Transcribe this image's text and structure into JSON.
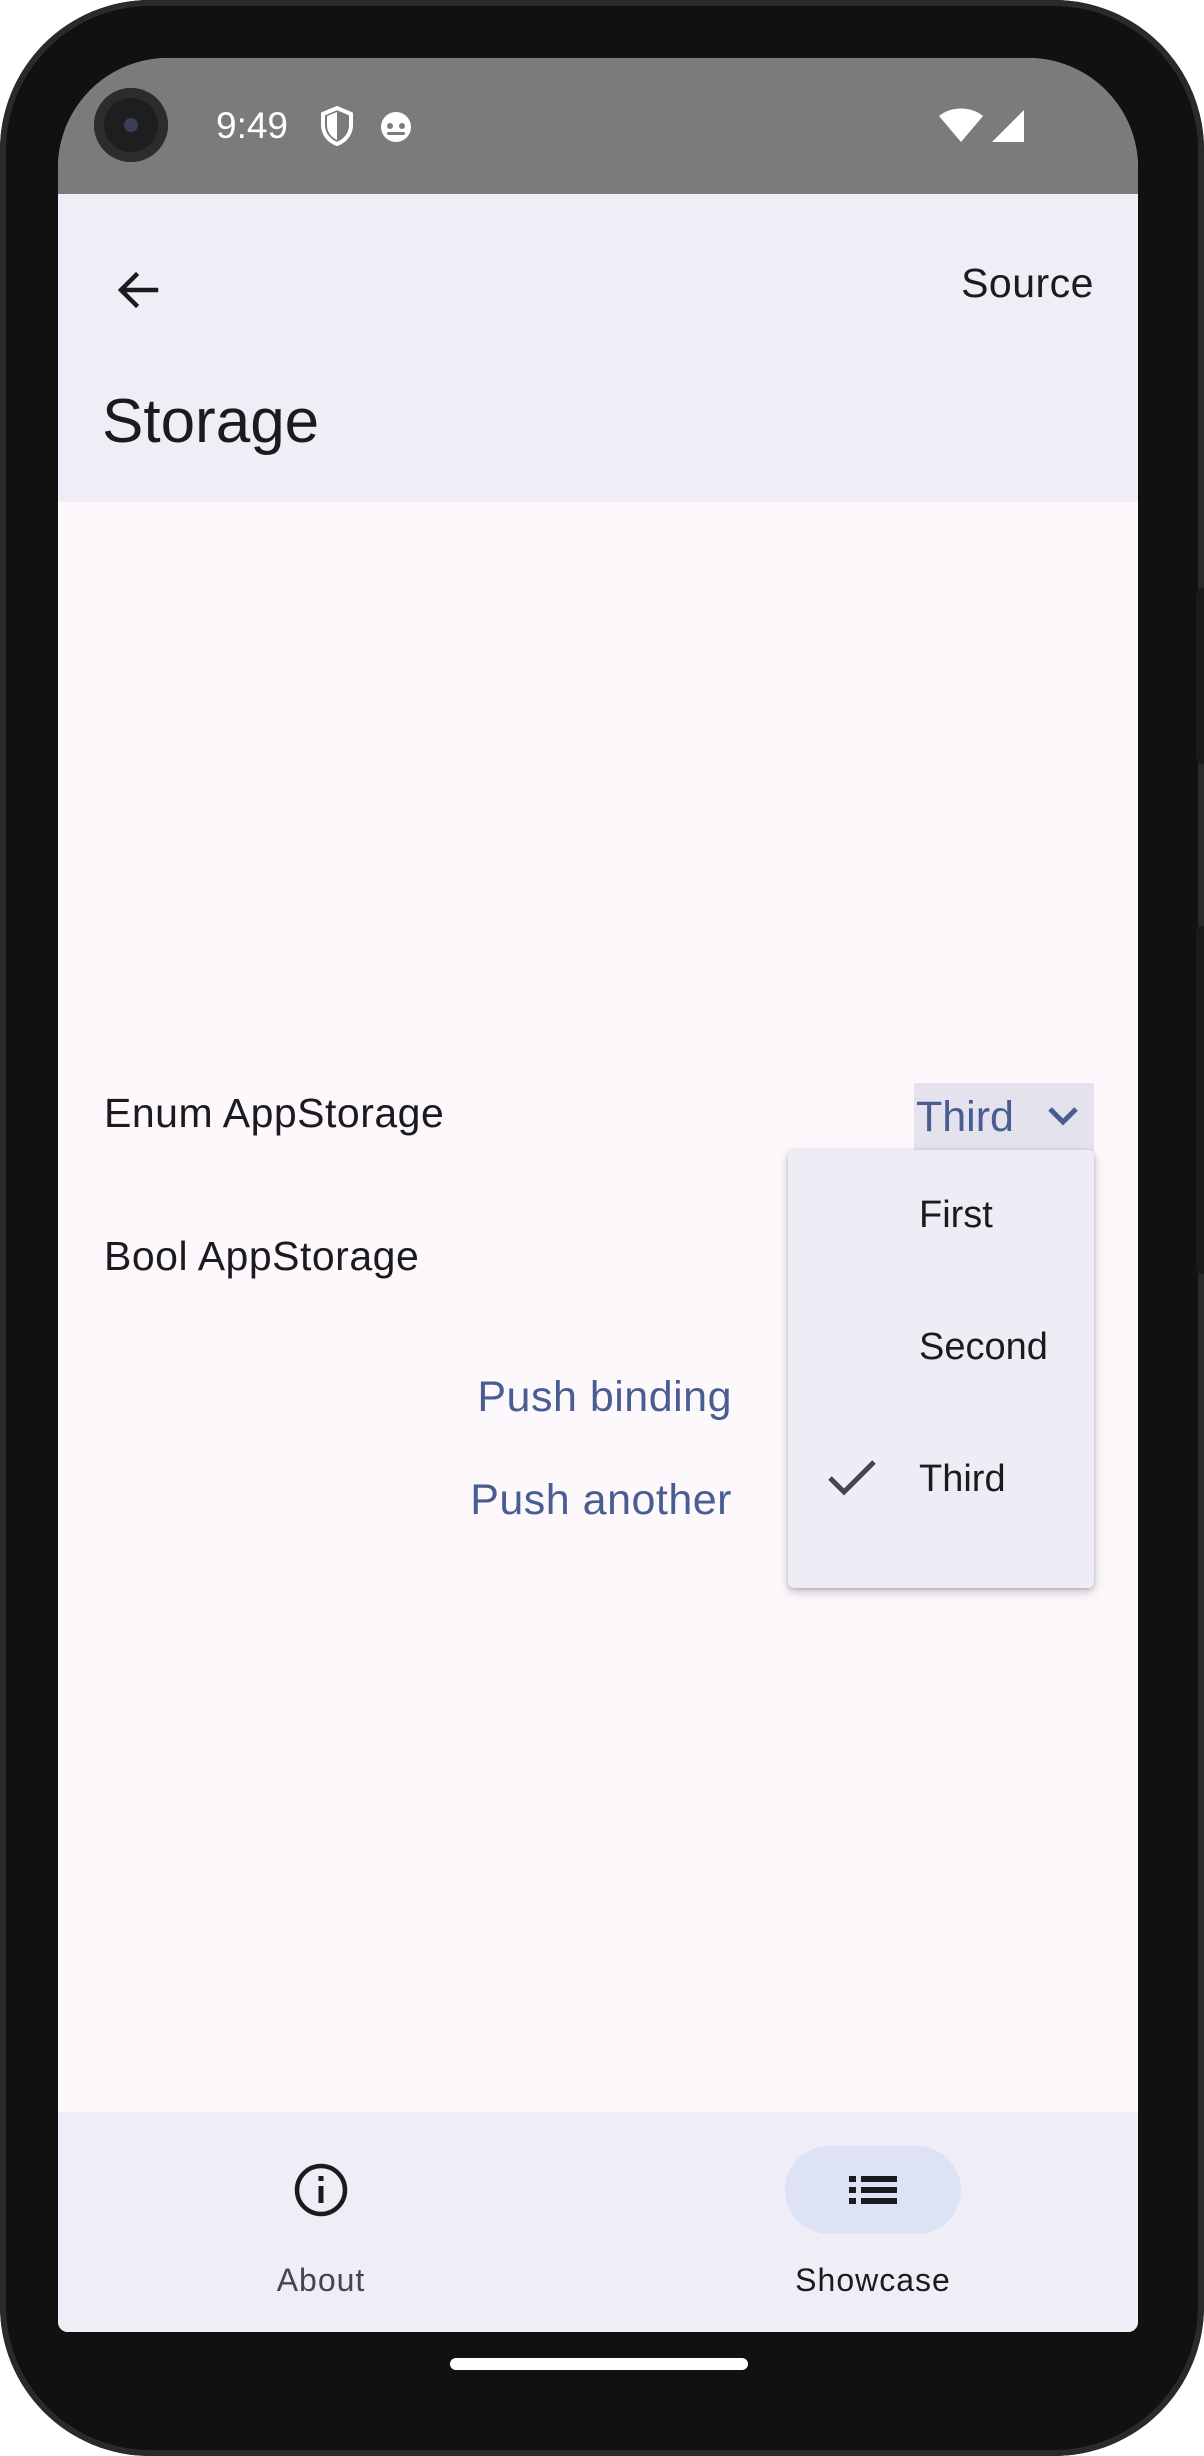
{
  "status_bar": {
    "time": "9:49",
    "icons": [
      "shield-icon",
      "cat-face-icon",
      "wifi-icon",
      "cellular-signal-icon"
    ]
  },
  "app_bar": {
    "back_icon": "arrow-left-icon",
    "source_label": "Source",
    "title": "Storage"
  },
  "content": {
    "enum_label": "Enum AppStorage",
    "enum_selected": "Third",
    "bool_label": "Bool AppStorage",
    "push_binding_label": "Push binding",
    "push_another_label": "Push another"
  },
  "dropdown": {
    "options": [
      {
        "label": "First",
        "selected": false
      },
      {
        "label": "Second",
        "selected": false
      },
      {
        "label": "Third",
        "selected": true
      }
    ]
  },
  "bottom_nav": {
    "items": [
      {
        "label": "About",
        "icon": "info-circle-icon",
        "active": false
      },
      {
        "label": "Showcase",
        "icon": "list-icon",
        "active": true
      }
    ]
  },
  "colors": {
    "accent": "#4a5d93",
    "app_bar_bg": "#efedf5",
    "surface": "#fcf8fb",
    "nav_indicator": "#dde2f5",
    "status_bar_bg": "#7b7b7b"
  }
}
